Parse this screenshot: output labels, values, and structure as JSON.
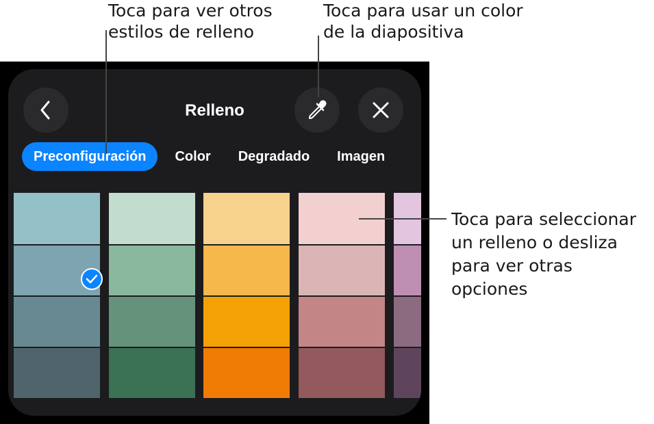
{
  "callouts": {
    "fill_styles": {
      "line1": "Toca para ver otros",
      "line2": "estilos de relleno"
    },
    "eyedropper": {
      "line1": "Toca para usar un color",
      "line2": "de la diapositiva"
    },
    "swatch": {
      "line1": "Toca para seleccionar",
      "line2": "un relleno o desliza",
      "line3": "para ver otras",
      "line4": "opciones"
    }
  },
  "panel": {
    "title": "Relleno",
    "tabs": [
      {
        "label": "Preconfiguración",
        "active": true
      },
      {
        "label": "Color",
        "active": false
      },
      {
        "label": "Degradado",
        "active": false
      },
      {
        "label": "Imagen",
        "active": false
      }
    ],
    "icons": {
      "back": "chevron-left-icon",
      "eyedropper": "eyedropper-icon",
      "close": "close-icon",
      "selected": "checkmark-icon"
    },
    "accent_color": "#0a84ff",
    "swatch_columns": [
      {
        "colors": [
          "#94c1c7",
          "#7ea4b2",
          "#678a92",
          "#4f646b"
        ]
      },
      {
        "colors": [
          "#c2dccd",
          "#8ab89e",
          "#64927a",
          "#3b7154"
        ]
      },
      {
        "colors": [
          "#f6d28d",
          "#f7b84b",
          "#f4a106",
          "#f07c06"
        ]
      },
      {
        "colors": [
          "#f2d0d0",
          "#dbb5b5",
          "#c48586",
          "#93595c"
        ]
      },
      {
        "colors": [
          "#e4c5e0",
          "#be8fb2",
          "#8c6b80",
          "#5f455c"
        ]
      }
    ],
    "selected_swatch": {
      "column": 1,
      "row": 2
    }
  }
}
